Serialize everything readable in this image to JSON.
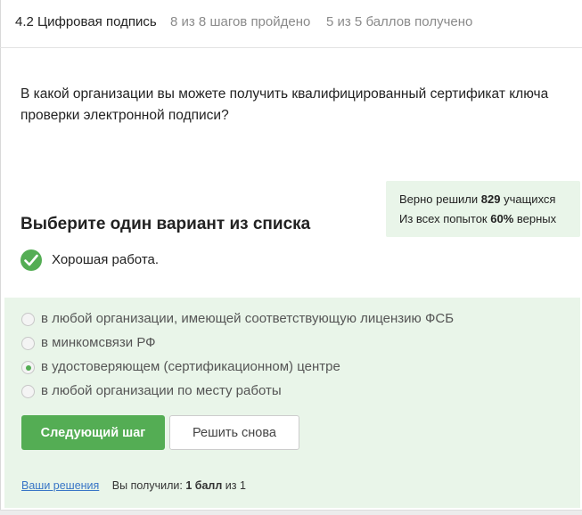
{
  "header": {
    "lesson_title": "4.2 Цифровая подпись",
    "steps_progress": "8 из 8 шагов пройдено",
    "score_progress": "5 из 5 баллов  получено"
  },
  "question": {
    "text": "В какой организации вы можете получить квалифицированный сертификат ключа проверки электронной подписи?"
  },
  "stats": {
    "line1_prefix": "Верно решили",
    "solved_count": "829",
    "line1_suffix": "учащихся",
    "line2_prefix": "Из всех попыток",
    "correct_percent": "60%",
    "line2_suffix": "верных"
  },
  "task": {
    "title": "Выберите один вариант из списка",
    "feedback": "Хорошая работа."
  },
  "options": [
    {
      "label": "в любой организации, имеющей соответствующую лицензию ФСБ",
      "selected": false
    },
    {
      "label": "в минкомсвязи РФ",
      "selected": false
    },
    {
      "label": "в удостоверяющем (сертификационном) центре",
      "selected": true
    },
    {
      "label": "в любой организации по месту работы",
      "selected": false
    }
  ],
  "buttons": {
    "next_label": "Следующий шаг",
    "retry_label": "Решить снова"
  },
  "footer": {
    "solutions_link": "Ваши решения",
    "received_prefix": "Вы получили:",
    "points": "1 балл",
    "received_suffix": "из 1"
  },
  "colors": {
    "accent_green": "#54ad54",
    "panel_green": "#e9f5e9",
    "link_blue": "#3875c6"
  },
  "icons": {
    "feedback": "checkmark-circle-icon"
  }
}
